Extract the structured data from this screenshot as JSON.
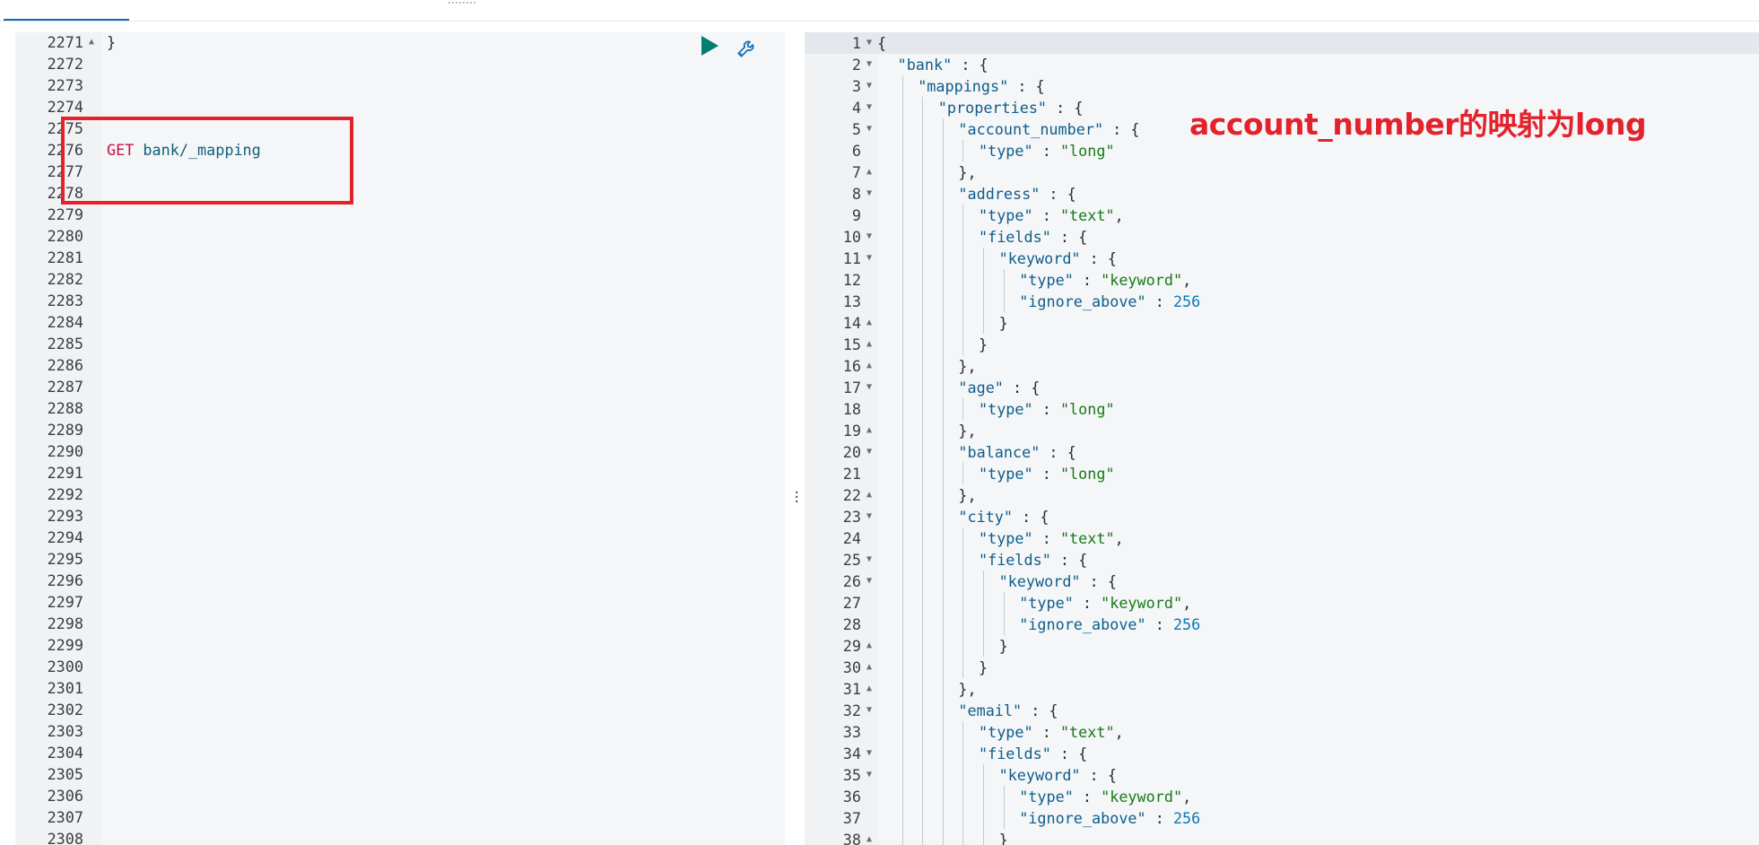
{
  "request_editor": {
    "first_line_number": 2271,
    "lines": [
      {
        "n": "2271",
        "fold": "▲",
        "tokens": [
          {
            "c": "k-punc",
            "t": "}"
          }
        ]
      },
      {
        "n": "2272",
        "tokens": []
      },
      {
        "n": "2273",
        "tokens": []
      },
      {
        "n": "2274",
        "tokens": []
      },
      {
        "n": "2275",
        "tokens": []
      },
      {
        "n": "2276",
        "tokens": [
          {
            "c": "k-method",
            "t": "GET "
          },
          {
            "c": "k-path",
            "t": "bank/_mapping"
          }
        ]
      },
      {
        "n": "2277",
        "tokens": []
      },
      {
        "n": "2278",
        "tokens": []
      },
      {
        "n": "2279",
        "tokens": []
      },
      {
        "n": "2280",
        "tokens": []
      },
      {
        "n": "2281",
        "tokens": []
      },
      {
        "n": "2282",
        "tokens": []
      },
      {
        "n": "2283",
        "tokens": []
      },
      {
        "n": "2284",
        "tokens": []
      },
      {
        "n": "2285",
        "tokens": []
      },
      {
        "n": "2286",
        "tokens": []
      },
      {
        "n": "2287",
        "tokens": []
      },
      {
        "n": "2288",
        "tokens": []
      },
      {
        "n": "2289",
        "tokens": []
      },
      {
        "n": "2290",
        "tokens": []
      },
      {
        "n": "2291",
        "tokens": []
      },
      {
        "n": "2292",
        "tokens": []
      },
      {
        "n": "2293",
        "tokens": []
      },
      {
        "n": "2294",
        "tokens": []
      },
      {
        "n": "2295",
        "tokens": []
      },
      {
        "n": "2296",
        "tokens": []
      },
      {
        "n": "2297",
        "tokens": []
      },
      {
        "n": "2298",
        "tokens": []
      },
      {
        "n": "2299",
        "tokens": []
      },
      {
        "n": "2300",
        "tokens": []
      },
      {
        "n": "2301",
        "tokens": []
      },
      {
        "n": "2302",
        "tokens": []
      },
      {
        "n": "2303",
        "tokens": []
      },
      {
        "n": "2304",
        "tokens": []
      },
      {
        "n": "2305",
        "tokens": []
      },
      {
        "n": "2306",
        "tokens": []
      },
      {
        "n": "2307",
        "tokens": []
      },
      {
        "n": "2308",
        "tokens": []
      }
    ]
  },
  "toolbar": {
    "run_icon": "play-icon",
    "settings_icon": "wrench-icon"
  },
  "response_editor": {
    "lines": [
      {
        "n": "1",
        "fold": "▼",
        "ind": 0,
        "tokens": [
          {
            "c": "k-punc",
            "t": "{"
          }
        ]
      },
      {
        "n": "2",
        "fold": "▼",
        "ind": 1,
        "tokens": [
          {
            "c": "k-key",
            "t": "\"bank\""
          },
          {
            "c": "k-punc",
            "t": " : {"
          }
        ]
      },
      {
        "n": "3",
        "fold": "▼",
        "ind": 2,
        "tokens": [
          {
            "c": "k-key",
            "t": "\"mappings\""
          },
          {
            "c": "k-punc",
            "t": " : {"
          }
        ]
      },
      {
        "n": "4",
        "fold": "▼",
        "ind": 3,
        "tokens": [
          {
            "c": "k-key",
            "t": "\"properties\""
          },
          {
            "c": "k-punc",
            "t": " : {"
          }
        ]
      },
      {
        "n": "5",
        "fold": "▼",
        "ind": 4,
        "tokens": [
          {
            "c": "k-key",
            "t": "\"account_number\""
          },
          {
            "c": "k-punc",
            "t": " : {"
          }
        ]
      },
      {
        "n": "6",
        "ind": 5,
        "tokens": [
          {
            "c": "k-key",
            "t": "\"type\""
          },
          {
            "c": "k-punc",
            "t": " : "
          },
          {
            "c": "k-str",
            "t": "\"long\""
          }
        ]
      },
      {
        "n": "7",
        "fold": "▲",
        "ind": 4,
        "tokens": [
          {
            "c": "k-punc",
            "t": "},"
          }
        ]
      },
      {
        "n": "8",
        "fold": "▼",
        "ind": 4,
        "tokens": [
          {
            "c": "k-key",
            "t": "\"address\""
          },
          {
            "c": "k-punc",
            "t": " : {"
          }
        ]
      },
      {
        "n": "9",
        "ind": 5,
        "tokens": [
          {
            "c": "k-key",
            "t": "\"type\""
          },
          {
            "c": "k-punc",
            "t": " : "
          },
          {
            "c": "k-str",
            "t": "\"text\""
          },
          {
            "c": "k-punc",
            "t": ","
          }
        ]
      },
      {
        "n": "10",
        "fold": "▼",
        "ind": 5,
        "tokens": [
          {
            "c": "k-key",
            "t": "\"fields\""
          },
          {
            "c": "k-punc",
            "t": " : {"
          }
        ]
      },
      {
        "n": "11",
        "fold": "▼",
        "ind": 6,
        "tokens": [
          {
            "c": "k-key",
            "t": "\"keyword\""
          },
          {
            "c": "k-punc",
            "t": " : {"
          }
        ]
      },
      {
        "n": "12",
        "ind": 7,
        "tokens": [
          {
            "c": "k-key",
            "t": "\"type\""
          },
          {
            "c": "k-punc",
            "t": " : "
          },
          {
            "c": "k-str",
            "t": "\"keyword\""
          },
          {
            "c": "k-punc",
            "t": ","
          }
        ]
      },
      {
        "n": "13",
        "ind": 7,
        "tokens": [
          {
            "c": "k-key",
            "t": "\"ignore_above\""
          },
          {
            "c": "k-punc",
            "t": " : "
          },
          {
            "c": "k-num",
            "t": "256"
          }
        ]
      },
      {
        "n": "14",
        "fold": "▲",
        "ind": 6,
        "tokens": [
          {
            "c": "k-punc",
            "t": "}"
          }
        ]
      },
      {
        "n": "15",
        "fold": "▲",
        "ind": 5,
        "tokens": [
          {
            "c": "k-punc",
            "t": "}"
          }
        ]
      },
      {
        "n": "16",
        "fold": "▲",
        "ind": 4,
        "tokens": [
          {
            "c": "k-punc",
            "t": "},"
          }
        ]
      },
      {
        "n": "17",
        "fold": "▼",
        "ind": 4,
        "tokens": [
          {
            "c": "k-key",
            "t": "\"age\""
          },
          {
            "c": "k-punc",
            "t": " : {"
          }
        ]
      },
      {
        "n": "18",
        "ind": 5,
        "tokens": [
          {
            "c": "k-key",
            "t": "\"type\""
          },
          {
            "c": "k-punc",
            "t": " : "
          },
          {
            "c": "k-str",
            "t": "\"long\""
          }
        ]
      },
      {
        "n": "19",
        "fold": "▲",
        "ind": 4,
        "tokens": [
          {
            "c": "k-punc",
            "t": "},"
          }
        ]
      },
      {
        "n": "20",
        "fold": "▼",
        "ind": 4,
        "tokens": [
          {
            "c": "k-key",
            "t": "\"balance\""
          },
          {
            "c": "k-punc",
            "t": " : {"
          }
        ]
      },
      {
        "n": "21",
        "ind": 5,
        "tokens": [
          {
            "c": "k-key",
            "t": "\"type\""
          },
          {
            "c": "k-punc",
            "t": " : "
          },
          {
            "c": "k-str",
            "t": "\"long\""
          }
        ]
      },
      {
        "n": "22",
        "fold": "▲",
        "ind": 4,
        "tokens": [
          {
            "c": "k-punc",
            "t": "},"
          }
        ]
      },
      {
        "n": "23",
        "fold": "▼",
        "ind": 4,
        "tokens": [
          {
            "c": "k-key",
            "t": "\"city\""
          },
          {
            "c": "k-punc",
            "t": " : {"
          }
        ]
      },
      {
        "n": "24",
        "ind": 5,
        "tokens": [
          {
            "c": "k-key",
            "t": "\"type\""
          },
          {
            "c": "k-punc",
            "t": " : "
          },
          {
            "c": "k-str",
            "t": "\"text\""
          },
          {
            "c": "k-punc",
            "t": ","
          }
        ]
      },
      {
        "n": "25",
        "fold": "▼",
        "ind": 5,
        "tokens": [
          {
            "c": "k-key",
            "t": "\"fields\""
          },
          {
            "c": "k-punc",
            "t": " : {"
          }
        ]
      },
      {
        "n": "26",
        "fold": "▼",
        "ind": 6,
        "tokens": [
          {
            "c": "k-key",
            "t": "\"keyword\""
          },
          {
            "c": "k-punc",
            "t": " : {"
          }
        ]
      },
      {
        "n": "27",
        "ind": 7,
        "tokens": [
          {
            "c": "k-key",
            "t": "\"type\""
          },
          {
            "c": "k-punc",
            "t": " : "
          },
          {
            "c": "k-str",
            "t": "\"keyword\""
          },
          {
            "c": "k-punc",
            "t": ","
          }
        ]
      },
      {
        "n": "28",
        "ind": 7,
        "tokens": [
          {
            "c": "k-key",
            "t": "\"ignore_above\""
          },
          {
            "c": "k-punc",
            "t": " : "
          },
          {
            "c": "k-num",
            "t": "256"
          }
        ]
      },
      {
        "n": "29",
        "fold": "▲",
        "ind": 6,
        "tokens": [
          {
            "c": "k-punc",
            "t": "}"
          }
        ]
      },
      {
        "n": "30",
        "fold": "▲",
        "ind": 5,
        "tokens": [
          {
            "c": "k-punc",
            "t": "}"
          }
        ]
      },
      {
        "n": "31",
        "fold": "▲",
        "ind": 4,
        "tokens": [
          {
            "c": "k-punc",
            "t": "},"
          }
        ]
      },
      {
        "n": "32",
        "fold": "▼",
        "ind": 4,
        "tokens": [
          {
            "c": "k-key",
            "t": "\"email\""
          },
          {
            "c": "k-punc",
            "t": " : {"
          }
        ]
      },
      {
        "n": "33",
        "ind": 5,
        "tokens": [
          {
            "c": "k-key",
            "t": "\"type\""
          },
          {
            "c": "k-punc",
            "t": " : "
          },
          {
            "c": "k-str",
            "t": "\"text\""
          },
          {
            "c": "k-punc",
            "t": ","
          }
        ]
      },
      {
        "n": "34",
        "fold": "▼",
        "ind": 5,
        "tokens": [
          {
            "c": "k-key",
            "t": "\"fields\""
          },
          {
            "c": "k-punc",
            "t": " : {"
          }
        ]
      },
      {
        "n": "35",
        "fold": "▼",
        "ind": 6,
        "tokens": [
          {
            "c": "k-key",
            "t": "\"keyword\""
          },
          {
            "c": "k-punc",
            "t": " : {"
          }
        ]
      },
      {
        "n": "36",
        "ind": 7,
        "tokens": [
          {
            "c": "k-key",
            "t": "\"type\""
          },
          {
            "c": "k-punc",
            "t": " : "
          },
          {
            "c": "k-str",
            "t": "\"keyword\""
          },
          {
            "c": "k-punc",
            "t": ","
          }
        ]
      },
      {
        "n": "37",
        "ind": 7,
        "tokens": [
          {
            "c": "k-key",
            "t": "\"ignore_above\""
          },
          {
            "c": "k-punc",
            "t": " : "
          },
          {
            "c": "k-num",
            "t": "256"
          }
        ]
      },
      {
        "n": "38",
        "fold": "▲",
        "ind": 6,
        "tokens": [
          {
            "c": "k-punc",
            "t": "}"
          }
        ]
      }
    ]
  },
  "annotation": {
    "text": "account_number的映射为long",
    "color": "#e3222b"
  },
  "colors": {
    "accent": "#0f6cb5",
    "run_button": "#017d73",
    "highlight_box": "#e3222b"
  }
}
